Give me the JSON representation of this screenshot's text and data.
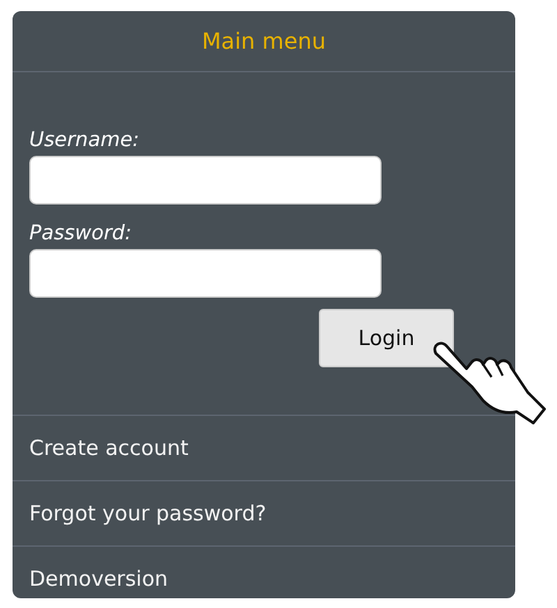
{
  "menu": {
    "title": "Main menu",
    "fields": [
      {
        "label": "Username:"
      },
      {
        "label": "Password:"
      }
    ],
    "login_button": "Login",
    "links": [
      "Create account",
      "Forgot your password?",
      "Demoversion"
    ]
  }
}
